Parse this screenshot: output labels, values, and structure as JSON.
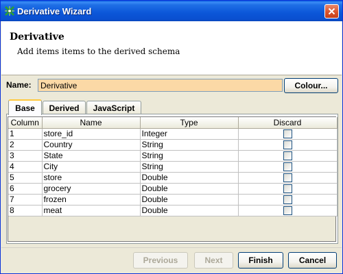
{
  "window": {
    "title": "Derivative Wizard",
    "close_icon": "close-icon"
  },
  "header": {
    "title": "Derivative",
    "subtitle": "Add items items to the derived schema"
  },
  "name_field": {
    "label": "Name:",
    "value": "Derivative",
    "background": "#fbd9a6"
  },
  "colour_button": "Colour...",
  "tabs": [
    {
      "label": "Base",
      "active": true
    },
    {
      "label": "Derived",
      "active": false
    },
    {
      "label": "JavaScript",
      "active": false
    }
  ],
  "table": {
    "columns": [
      "Column",
      "Name",
      "Type",
      "Discard"
    ],
    "rows": [
      {
        "column": "1",
        "name": "store_id",
        "type": "Integer",
        "discard": false
      },
      {
        "column": "2",
        "name": "Country",
        "type": "String",
        "discard": false
      },
      {
        "column": "3",
        "name": "State",
        "type": "String",
        "discard": false
      },
      {
        "column": "4",
        "name": "City",
        "type": "String",
        "discard": false
      },
      {
        "column": "5",
        "name": "store",
        "type": "Double",
        "discard": false
      },
      {
        "column": "6",
        "name": "grocery",
        "type": "Double",
        "discard": false
      },
      {
        "column": "7",
        "name": "frozen",
        "type": "Double",
        "discard": false
      },
      {
        "column": "8",
        "name": "meat",
        "type": "Double",
        "discard": false
      }
    ]
  },
  "buttons": {
    "previous": {
      "label": "Previous",
      "enabled": false
    },
    "next": {
      "label": "Next",
      "enabled": false
    },
    "finish": {
      "label": "Finish",
      "enabled": true
    },
    "cancel": {
      "label": "Cancel",
      "enabled": true
    }
  }
}
